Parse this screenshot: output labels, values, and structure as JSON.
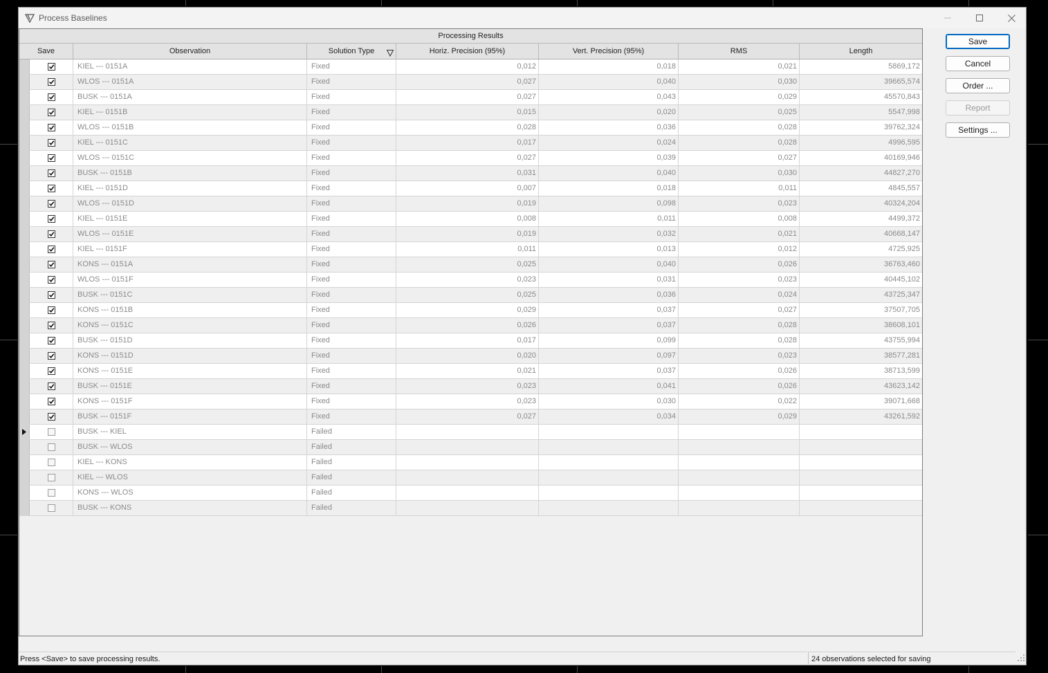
{
  "window": {
    "title": "Process Baselines",
    "controls": {
      "minimize": "minimize-icon",
      "maximize": "maximize-icon",
      "close": "close-icon"
    }
  },
  "grid": {
    "band_title": "Processing Results",
    "columns": [
      "Save",
      "Observation",
      "Solution Type",
      "Horiz. Precision (95%)",
      "Vert. Precision (95%)",
      "RMS",
      "Length"
    ],
    "rows": [
      {
        "save": true,
        "observation": "KIEL --- 0151A",
        "solution_type": "Fixed",
        "horiz": "0,012",
        "vert": "0,018",
        "rms": "0,021",
        "length": "5869,172"
      },
      {
        "save": true,
        "observation": "WLOS --- 0151A",
        "solution_type": "Fixed",
        "horiz": "0,027",
        "vert": "0,040",
        "rms": "0,030",
        "length": "39665,574"
      },
      {
        "save": true,
        "observation": "BUSK --- 0151A",
        "solution_type": "Fixed",
        "horiz": "0,027",
        "vert": "0,043",
        "rms": "0,029",
        "length": "45570,843"
      },
      {
        "save": true,
        "observation": "KIEL --- 0151B",
        "solution_type": "Fixed",
        "horiz": "0,015",
        "vert": "0,020",
        "rms": "0,025",
        "length": "5547,998"
      },
      {
        "save": true,
        "observation": "WLOS --- 0151B",
        "solution_type": "Fixed",
        "horiz": "0,028",
        "vert": "0,036",
        "rms": "0,028",
        "length": "39762,324"
      },
      {
        "save": true,
        "observation": "KIEL --- 0151C",
        "solution_type": "Fixed",
        "horiz": "0,017",
        "vert": "0,024",
        "rms": "0,028",
        "length": "4996,595"
      },
      {
        "save": true,
        "observation": "WLOS --- 0151C",
        "solution_type": "Fixed",
        "horiz": "0,027",
        "vert": "0,039",
        "rms": "0,027",
        "length": "40169,946"
      },
      {
        "save": true,
        "observation": "BUSK --- 0151B",
        "solution_type": "Fixed",
        "horiz": "0,031",
        "vert": "0,040",
        "rms": "0,030",
        "length": "44827,270"
      },
      {
        "save": true,
        "observation": "KIEL --- 0151D",
        "solution_type": "Fixed",
        "horiz": "0,007",
        "vert": "0,018",
        "rms": "0,011",
        "length": "4845,557"
      },
      {
        "save": true,
        "observation": "WLOS --- 0151D",
        "solution_type": "Fixed",
        "horiz": "0,019",
        "vert": "0,098",
        "rms": "0,023",
        "length": "40324,204"
      },
      {
        "save": true,
        "observation": "KIEL --- 0151E",
        "solution_type": "Fixed",
        "horiz": "0,008",
        "vert": "0,011",
        "rms": "0,008",
        "length": "4499,372"
      },
      {
        "save": true,
        "observation": "WLOS --- 0151E",
        "solution_type": "Fixed",
        "horiz": "0,019",
        "vert": "0,032",
        "rms": "0,021",
        "length": "40668,147"
      },
      {
        "save": true,
        "observation": "KIEL --- 0151F",
        "solution_type": "Fixed",
        "horiz": "0,011",
        "vert": "0,013",
        "rms": "0,012",
        "length": "4725,925"
      },
      {
        "save": true,
        "observation": "KONS --- 0151A",
        "solution_type": "Fixed",
        "horiz": "0,025",
        "vert": "0,040",
        "rms": "0,026",
        "length": "36763,460"
      },
      {
        "save": true,
        "observation": "WLOS --- 0151F",
        "solution_type": "Fixed",
        "horiz": "0,023",
        "vert": "0,031",
        "rms": "0,023",
        "length": "40445,102"
      },
      {
        "save": true,
        "observation": "BUSK --- 0151C",
        "solution_type": "Fixed",
        "horiz": "0,025",
        "vert": "0,036",
        "rms": "0,024",
        "length": "43725,347"
      },
      {
        "save": true,
        "observation": "KONS --- 0151B",
        "solution_type": "Fixed",
        "horiz": "0,029",
        "vert": "0,037",
        "rms": "0,027",
        "length": "37507,705"
      },
      {
        "save": true,
        "observation": "KONS --- 0151C",
        "solution_type": "Fixed",
        "horiz": "0,026",
        "vert": "0,037",
        "rms": "0,028",
        "length": "38608,101"
      },
      {
        "save": true,
        "observation": "BUSK --- 0151D",
        "solution_type": "Fixed",
        "horiz": "0,017",
        "vert": "0,099",
        "rms": "0,028",
        "length": "43755,994"
      },
      {
        "save": true,
        "observation": "KONS --- 0151D",
        "solution_type": "Fixed",
        "horiz": "0,020",
        "vert": "0,097",
        "rms": "0,023",
        "length": "38577,281"
      },
      {
        "save": true,
        "observation": "KONS --- 0151E",
        "solution_type": "Fixed",
        "horiz": "0,021",
        "vert": "0,037",
        "rms": "0,026",
        "length": "38713,599"
      },
      {
        "save": true,
        "observation": "BUSK --- 0151E",
        "solution_type": "Fixed",
        "horiz": "0,023",
        "vert": "0,041",
        "rms": "0,026",
        "length": "43623,142"
      },
      {
        "save": true,
        "observation": "KONS --- 0151F",
        "solution_type": "Fixed",
        "horiz": "0,023",
        "vert": "0,030",
        "rms": "0,022",
        "length": "39071,668"
      },
      {
        "save": true,
        "observation": "BUSK --- 0151F",
        "solution_type": "Fixed",
        "horiz": "0,027",
        "vert": "0,034",
        "rms": "0,029",
        "length": "43261,592"
      },
      {
        "save": false,
        "current": true,
        "observation": "BUSK --- KIEL",
        "solution_type": "Failed",
        "horiz": "",
        "vert": "",
        "rms": "",
        "length": ""
      },
      {
        "save": false,
        "observation": "BUSK --- WLOS",
        "solution_type": "Failed",
        "horiz": "",
        "vert": "",
        "rms": "",
        "length": ""
      },
      {
        "save": false,
        "observation": "KIEL --- KONS",
        "solution_type": "Failed",
        "horiz": "",
        "vert": "",
        "rms": "",
        "length": ""
      },
      {
        "save": false,
        "observation": "KIEL --- WLOS",
        "solution_type": "Failed",
        "horiz": "",
        "vert": "",
        "rms": "",
        "length": ""
      },
      {
        "save": false,
        "observation": "KONS --- WLOS",
        "solution_type": "Failed",
        "horiz": "",
        "vert": "",
        "rms": "",
        "length": ""
      },
      {
        "save": false,
        "observation": "BUSK --- KONS",
        "solution_type": "Failed",
        "horiz": "",
        "vert": "",
        "rms": "",
        "length": ""
      }
    ]
  },
  "buttons": {
    "save": "Save",
    "cancel": "Cancel",
    "order": "Order ...",
    "report": "Report",
    "settings": "Settings ..."
  },
  "status": {
    "left": "Press <Save> to save processing results.",
    "right": "24 observations selected for saving"
  },
  "colors": {
    "accent": "#0067c0",
    "row_alt": "#efefef",
    "header": "#e3e3e3"
  }
}
